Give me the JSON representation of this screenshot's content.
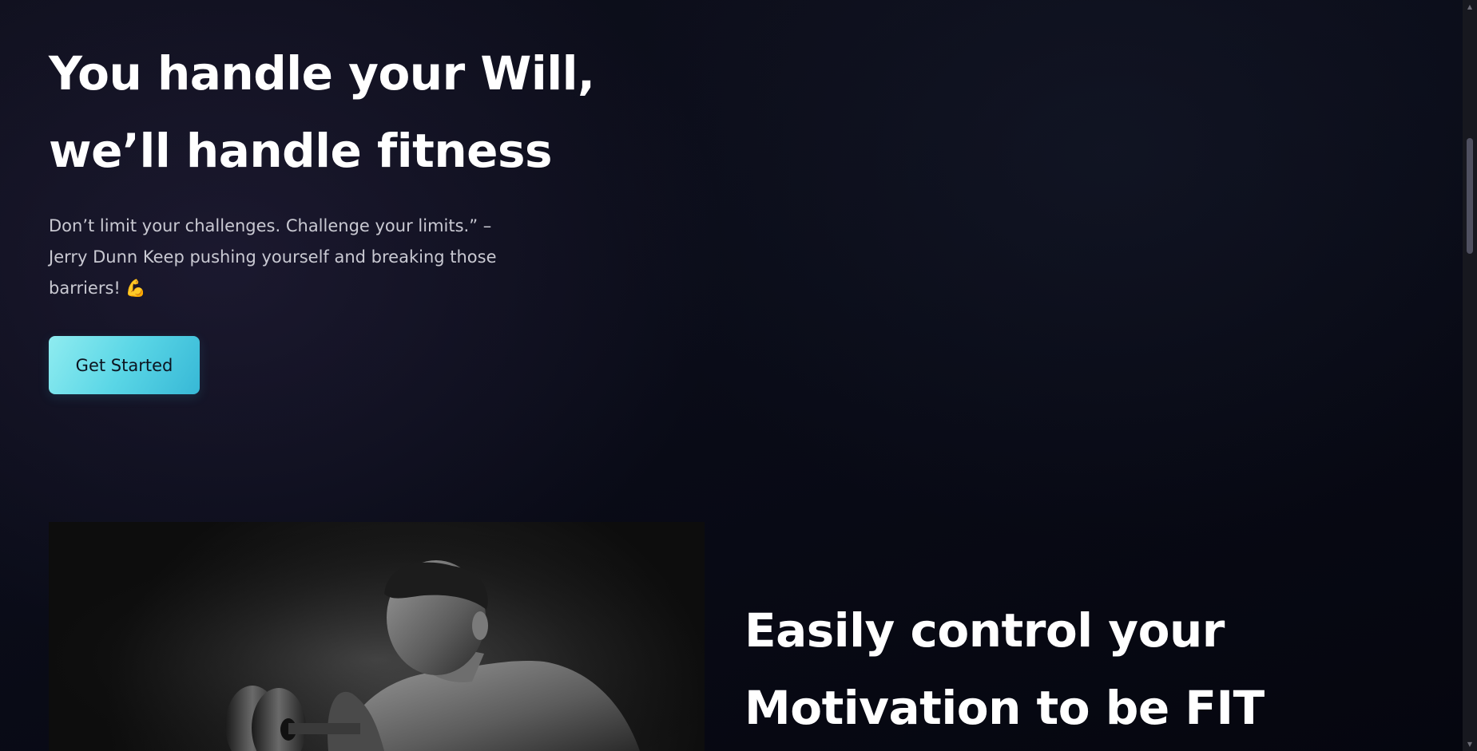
{
  "hero": {
    "title_line1": "You handle your Will,",
    "title_line2": "we’ll handle fitness",
    "quote": "Don’t limit your challenges. Challenge your limits.” – Jerry Dunn Keep pushing yourself and breaking those barriers!",
    "quote_emoji": "💪",
    "cta_label": "Get Started"
  },
  "section2": {
    "title_line1": "Easily control your",
    "title_line2": "Motivation to be FIT"
  },
  "photo": {
    "subject": "man-lifting-dumbbell-photo"
  },
  "scrollbar": {
    "up_arrow": "▲",
    "down_arrow": "▼"
  },
  "colors": {
    "background": "#0a0c18",
    "cta_gradient_start": "#8fecf0",
    "cta_gradient_end": "#37b8d6",
    "text_primary": "#ffffff",
    "text_secondary": "#c9c9d2"
  }
}
